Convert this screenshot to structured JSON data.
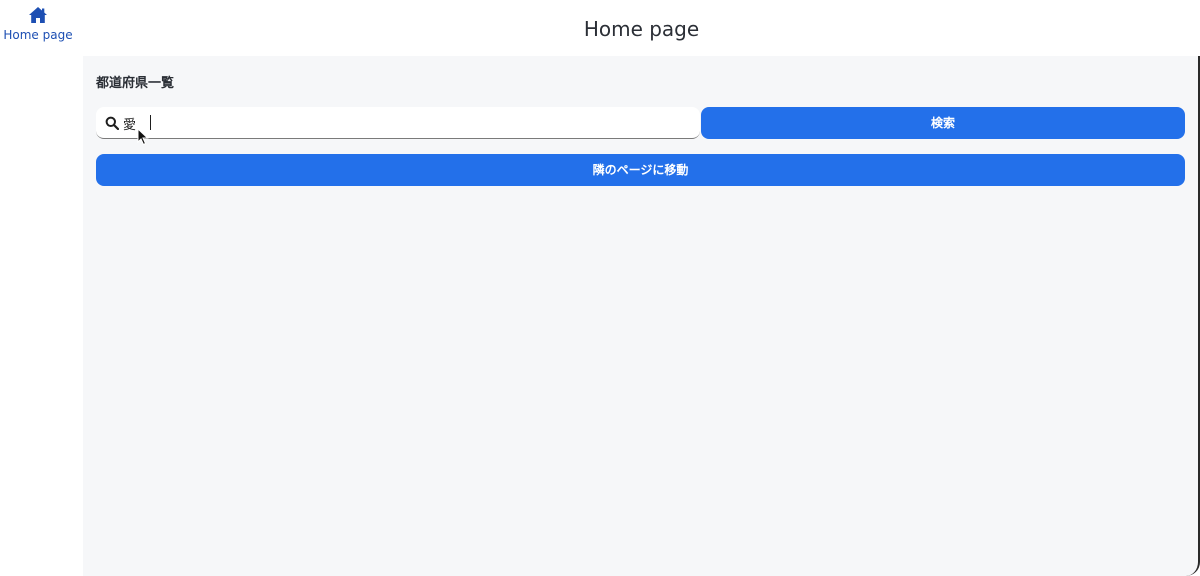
{
  "sidebar": {
    "items": [
      {
        "label": "Home page",
        "icon": "home-icon"
      }
    ]
  },
  "header": {
    "title": "Home page"
  },
  "main": {
    "section_title": "都道府県一覧",
    "search": {
      "value": "愛",
      "placeholder": ""
    },
    "search_button_label": "検索",
    "next_page_button_label": "隣のページに移動"
  },
  "colors": {
    "accent": "#2370ea",
    "nav_text": "#1d4fb3",
    "content_bg": "#f6f7f9"
  }
}
